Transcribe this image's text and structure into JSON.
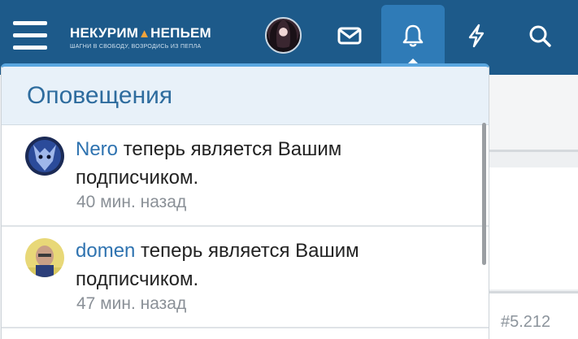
{
  "header": {
    "logo_text": "НЕКУРИМ",
    "logo_text2": "НЕПЬЕМ",
    "logo_tagline": "ШАГНИ В СВОБОДУ, ВОЗРОДИСЬ ИЗ ПЕПЛА",
    "icons": [
      "menu-icon",
      "avatar",
      "envelope-icon",
      "bell-icon",
      "lightning-icon",
      "search-icon"
    ],
    "active_icon": "bell-icon"
  },
  "notifications": {
    "title": "Оповещения",
    "items": [
      {
        "user": "Nero",
        "text": " теперь является Вашим подписчиком.",
        "time": "40 мин. назад"
      },
      {
        "user": "domen",
        "text": " теперь является Вашим подписчиком.",
        "time": "47 мин. назад"
      }
    ]
  },
  "background": {
    "post_number": "#5.212"
  },
  "colors": {
    "topbar": "#1d5a8a",
    "accent": "#2f7bb7",
    "link": "#2f73b0",
    "popup_header": "#e8f1f9"
  }
}
